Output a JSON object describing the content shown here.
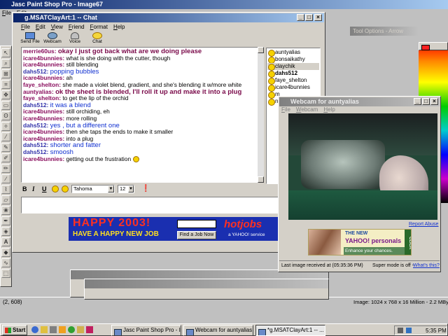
{
  "psp": {
    "title": "Jasc Paint Shop Pro - Image67",
    "menu": [
      "File",
      "Edit"
    ],
    "tool_options": "Tool Options - Arrow",
    "status_left": "(2, 608)",
    "status_right": "Image: 1024 x 768 x 16 Million - 2.2 MBytes"
  },
  "chat": {
    "title": "g.MSATClayArt:1 -- Chat",
    "menu": [
      "File",
      "Edit",
      "View",
      "Friend",
      "Format",
      "Help"
    ],
    "toolbar": [
      "Send File",
      "Webcam",
      "Voice",
      "Chat"
    ],
    "messages": [
      {
        "nick": "merrie60us:",
        "text": "okay I just got back what are we doing please",
        "style": "maroon"
      },
      {
        "nick": "icare4bunnies:",
        "text": "what is she doing with the cutter, though",
        "style": "plain"
      },
      {
        "nick": "icare4bunnies:",
        "text": "still blending",
        "style": "plain"
      },
      {
        "nick": "dahs512:",
        "text": "popping bubbles",
        "style": "blue"
      },
      {
        "nick": "icare4bunnies:",
        "text": "ah",
        "style": "plain"
      },
      {
        "nick": "faye_shelton:",
        "text": "she made a violet blend, gradient, and she's blending it w/more white",
        "style": "plain"
      },
      {
        "nick": "auntyalias:",
        "text": "ok the sheet is blended, I'll roll it up and make it into a plug",
        "style": "maroon"
      },
      {
        "nick": "faye_shelton:",
        "text": "to get the lip of the orchid",
        "style": "plain"
      },
      {
        "nick": "dahs512:",
        "text": "it was a blend",
        "style": "blue"
      },
      {
        "nick": "icare4bunnies:",
        "text": "still orchiding, eh",
        "style": "plain"
      },
      {
        "nick": "icare4bunnies:",
        "text": "more rolling",
        "style": "plain"
      },
      {
        "nick": "dahs512:",
        "text": "yes , but a different one",
        "style": "blue"
      },
      {
        "nick": "icare4bunnies:",
        "text": "then she taps the ends to make it smaller",
        "style": "plain"
      },
      {
        "nick": "icare4bunnies:",
        "text": "into a plug",
        "style": "plain"
      },
      {
        "nick": "dahs512:",
        "text": "shorter and fatter",
        "style": "blue"
      },
      {
        "nick": "dahs512:",
        "text": "smoosh",
        "style": "blue"
      },
      {
        "nick": "icare4bunnies:",
        "text": "getting out the frustration",
        "style": "plain"
      }
    ],
    "users": [
      "auntyalias",
      "bonsaikathy",
      "claychik",
      "dahs512",
      "faye_shelton",
      "icare4bunnies",
      "m",
      "n"
    ],
    "selected_user": "claychik",
    "format": {
      "bold": "B",
      "italic": "I",
      "underline": "U",
      "font": "Tahoma",
      "size": "12"
    },
    "banner": {
      "headline": "HAPPY 2003!",
      "sub": "HAVE A HAPPY NEW JOB",
      "brand": "hotjobs",
      "brand_sub": "a YAHOO! service",
      "button": "Find a Job Now"
    }
  },
  "webcam": {
    "title": "Webcam for auntyalias",
    "menu": [
      "File",
      "Webcam",
      "Help"
    ],
    "report": "Report Abuse",
    "ad": {
      "top": "THE NEW",
      "brand": "YAHOO! personals",
      "tagline": "Enhance your chances.",
      "click": "CLICK"
    },
    "status": "Last image received at (05:35:36 PM)",
    "super_mode": "Super mode is off -",
    "whats_this": "What's this?"
  },
  "taskbar": {
    "start": "Start",
    "buttons": [
      "Jasc Paint Shop Pro - Ima...",
      "Webcam for auntyalias",
      "*g.MSATClayArt:1 -- ..."
    ],
    "clock": "5:35 PM"
  },
  "colors": {
    "titlebar": "#0a246a",
    "desktop": "#808080",
    "chat_nick": "#8a0f5e",
    "chat_blue": "#1030d0"
  }
}
